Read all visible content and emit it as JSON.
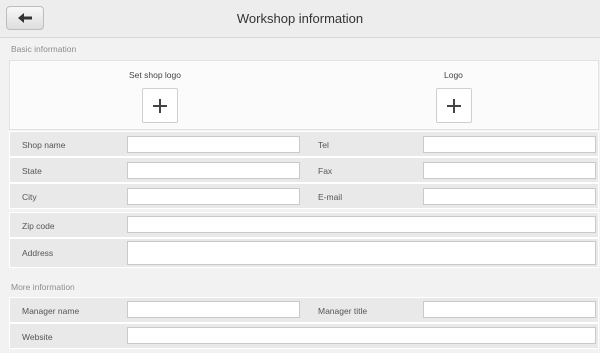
{
  "header": {
    "title": "Workshop information",
    "back_icon": "arrow-left-icon"
  },
  "basic": {
    "section_title": "Basic information",
    "set_logo_label": "Set shop logo",
    "logo_label": "Logo",
    "add_icon": "plus-icon",
    "fields": {
      "shop_name": {
        "label": "Shop name",
        "value": ""
      },
      "tel": {
        "label": "Tel",
        "value": ""
      },
      "state": {
        "label": "State",
        "value": ""
      },
      "fax": {
        "label": "Fax",
        "value": ""
      },
      "city": {
        "label": "City",
        "value": ""
      },
      "email": {
        "label": "E-mail",
        "value": ""
      },
      "zip": {
        "label": "Zip code",
        "value": ""
      },
      "address": {
        "label": "Address",
        "value": ""
      }
    }
  },
  "more": {
    "section_title": "More information",
    "fields": {
      "manager_name": {
        "label": "Manager name",
        "value": ""
      },
      "manager_title": {
        "label": "Manager title",
        "value": ""
      },
      "website": {
        "label": "Website",
        "value": ""
      }
    }
  },
  "colors": {
    "background": "#f2f2f2",
    "row": "#e9e9e9",
    "input_border": "#c9c9c9"
  }
}
